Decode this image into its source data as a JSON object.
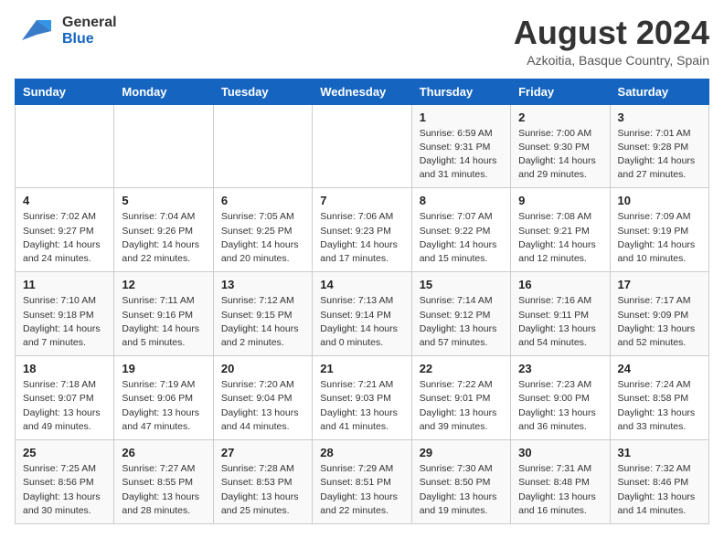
{
  "header": {
    "month_year": "August 2024",
    "location": "Azkoitia, Basque Country, Spain",
    "logo_general": "General",
    "logo_blue": "Blue"
  },
  "days_of_week": [
    "Sunday",
    "Monday",
    "Tuesday",
    "Wednesday",
    "Thursday",
    "Friday",
    "Saturday"
  ],
  "weeks": [
    [
      {
        "day": "",
        "info": ""
      },
      {
        "day": "",
        "info": ""
      },
      {
        "day": "",
        "info": ""
      },
      {
        "day": "",
        "info": ""
      },
      {
        "day": "1",
        "info": "Sunrise: 6:59 AM\nSunset: 9:31 PM\nDaylight: 14 hours\nand 31 minutes."
      },
      {
        "day": "2",
        "info": "Sunrise: 7:00 AM\nSunset: 9:30 PM\nDaylight: 14 hours\nand 29 minutes."
      },
      {
        "day": "3",
        "info": "Sunrise: 7:01 AM\nSunset: 9:28 PM\nDaylight: 14 hours\nand 27 minutes."
      }
    ],
    [
      {
        "day": "4",
        "info": "Sunrise: 7:02 AM\nSunset: 9:27 PM\nDaylight: 14 hours\nand 24 minutes."
      },
      {
        "day": "5",
        "info": "Sunrise: 7:04 AM\nSunset: 9:26 PM\nDaylight: 14 hours\nand 22 minutes."
      },
      {
        "day": "6",
        "info": "Sunrise: 7:05 AM\nSunset: 9:25 PM\nDaylight: 14 hours\nand 20 minutes."
      },
      {
        "day": "7",
        "info": "Sunrise: 7:06 AM\nSunset: 9:23 PM\nDaylight: 14 hours\nand 17 minutes."
      },
      {
        "day": "8",
        "info": "Sunrise: 7:07 AM\nSunset: 9:22 PM\nDaylight: 14 hours\nand 15 minutes."
      },
      {
        "day": "9",
        "info": "Sunrise: 7:08 AM\nSunset: 9:21 PM\nDaylight: 14 hours\nand 12 minutes."
      },
      {
        "day": "10",
        "info": "Sunrise: 7:09 AM\nSunset: 9:19 PM\nDaylight: 14 hours\nand 10 minutes."
      }
    ],
    [
      {
        "day": "11",
        "info": "Sunrise: 7:10 AM\nSunset: 9:18 PM\nDaylight: 14 hours\nand 7 minutes."
      },
      {
        "day": "12",
        "info": "Sunrise: 7:11 AM\nSunset: 9:16 PM\nDaylight: 14 hours\nand 5 minutes."
      },
      {
        "day": "13",
        "info": "Sunrise: 7:12 AM\nSunset: 9:15 PM\nDaylight: 14 hours\nand 2 minutes."
      },
      {
        "day": "14",
        "info": "Sunrise: 7:13 AM\nSunset: 9:14 PM\nDaylight: 14 hours\nand 0 minutes."
      },
      {
        "day": "15",
        "info": "Sunrise: 7:14 AM\nSunset: 9:12 PM\nDaylight: 13 hours\nand 57 minutes."
      },
      {
        "day": "16",
        "info": "Sunrise: 7:16 AM\nSunset: 9:11 PM\nDaylight: 13 hours\nand 54 minutes."
      },
      {
        "day": "17",
        "info": "Sunrise: 7:17 AM\nSunset: 9:09 PM\nDaylight: 13 hours\nand 52 minutes."
      }
    ],
    [
      {
        "day": "18",
        "info": "Sunrise: 7:18 AM\nSunset: 9:07 PM\nDaylight: 13 hours\nand 49 minutes."
      },
      {
        "day": "19",
        "info": "Sunrise: 7:19 AM\nSunset: 9:06 PM\nDaylight: 13 hours\nand 47 minutes."
      },
      {
        "day": "20",
        "info": "Sunrise: 7:20 AM\nSunset: 9:04 PM\nDaylight: 13 hours\nand 44 minutes."
      },
      {
        "day": "21",
        "info": "Sunrise: 7:21 AM\nSunset: 9:03 PM\nDaylight: 13 hours\nand 41 minutes."
      },
      {
        "day": "22",
        "info": "Sunrise: 7:22 AM\nSunset: 9:01 PM\nDaylight: 13 hours\nand 39 minutes."
      },
      {
        "day": "23",
        "info": "Sunrise: 7:23 AM\nSunset: 9:00 PM\nDaylight: 13 hours\nand 36 minutes."
      },
      {
        "day": "24",
        "info": "Sunrise: 7:24 AM\nSunset: 8:58 PM\nDaylight: 13 hours\nand 33 minutes."
      }
    ],
    [
      {
        "day": "25",
        "info": "Sunrise: 7:25 AM\nSunset: 8:56 PM\nDaylight: 13 hours\nand 30 minutes."
      },
      {
        "day": "26",
        "info": "Sunrise: 7:27 AM\nSunset: 8:55 PM\nDaylight: 13 hours\nand 28 minutes."
      },
      {
        "day": "27",
        "info": "Sunrise: 7:28 AM\nSunset: 8:53 PM\nDaylight: 13 hours\nand 25 minutes."
      },
      {
        "day": "28",
        "info": "Sunrise: 7:29 AM\nSunset: 8:51 PM\nDaylight: 13 hours\nand 22 minutes."
      },
      {
        "day": "29",
        "info": "Sunrise: 7:30 AM\nSunset: 8:50 PM\nDaylight: 13 hours\nand 19 minutes."
      },
      {
        "day": "30",
        "info": "Sunrise: 7:31 AM\nSunset: 8:48 PM\nDaylight: 13 hours\nand 16 minutes."
      },
      {
        "day": "31",
        "info": "Sunrise: 7:32 AM\nSunset: 8:46 PM\nDaylight: 13 hours\nand 14 minutes."
      }
    ]
  ]
}
